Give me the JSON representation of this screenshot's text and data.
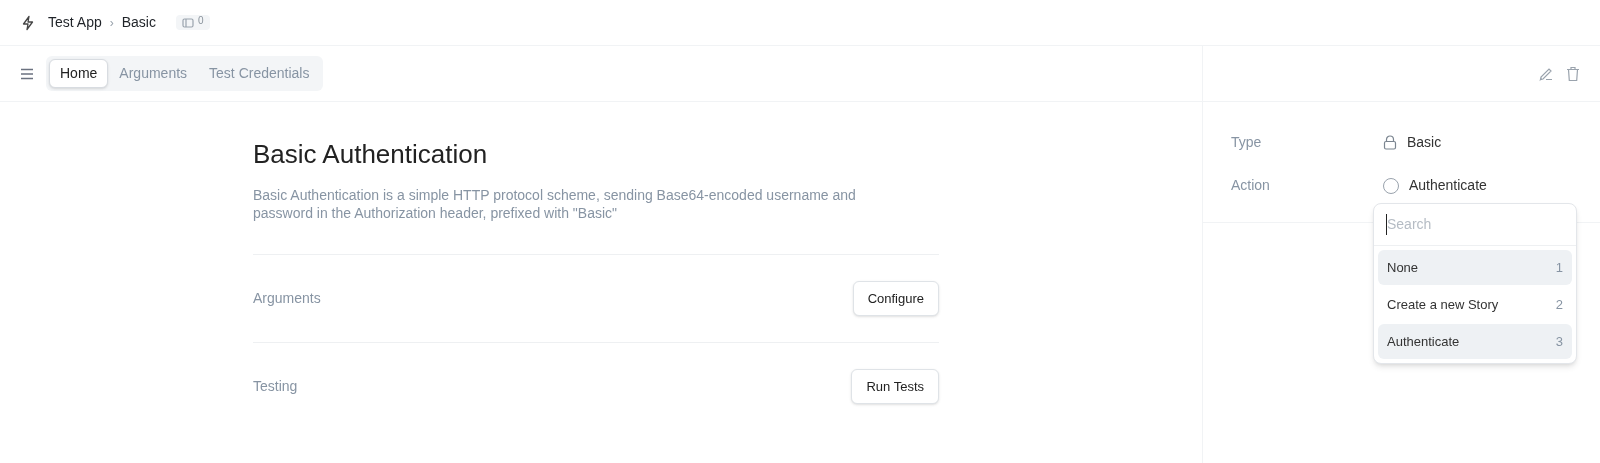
{
  "breadcrumb": {
    "app": "Test App",
    "separator": "›",
    "page": "Basic",
    "badge_count": "0"
  },
  "tabs": [
    {
      "label": "Home",
      "selected": true
    },
    {
      "label": "Arguments",
      "selected": false
    },
    {
      "label": "Test Credentials",
      "selected": false
    }
  ],
  "main": {
    "title": "Basic Authentication",
    "description": "Basic Authentication is a simple HTTP protocol scheme, sending Base64-encoded username and password in the Authorization header, prefixed with \"Basic\"",
    "sections": [
      {
        "label": "Arguments",
        "button": "Configure"
      },
      {
        "label": "Testing",
        "button": "Run Tests"
      }
    ]
  },
  "details": [
    {
      "label": "Type",
      "kind": "lock",
      "value": "Basic"
    },
    {
      "label": "Action",
      "kind": "radio",
      "value": "Authenticate",
      "checked": false
    }
  ],
  "dropdown": {
    "placeholder": "Search",
    "options": [
      {
        "label": "None",
        "shortcut": "1",
        "highlighted": true
      },
      {
        "label": "Create a new Story",
        "shortcut": "2",
        "highlighted": false
      },
      {
        "label": "Authenticate",
        "shortcut": "3",
        "highlighted": true
      }
    ]
  }
}
